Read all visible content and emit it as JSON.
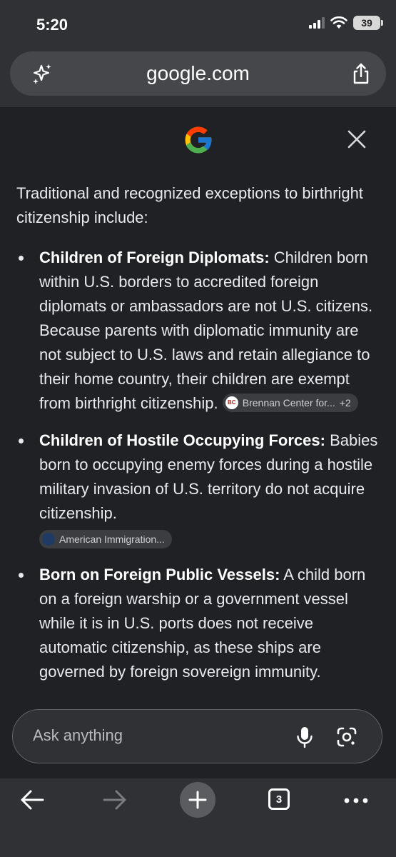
{
  "status_bar": {
    "time": "5:20",
    "battery": "39"
  },
  "address_bar": {
    "url": "google.com"
  },
  "answer": {
    "intro": "Traditional and recognized exceptions to birthright citizenship include:",
    "points": [
      {
        "term": "Children of Foreign Diplomats:",
        "text": " Children born within U.S. borders to accredited foreign diplomats or ambassadors are not U.S. citizens. Because parents with diplomatic immunity are not subject to U.S. laws and retain allegiance to their home country, their children are exempt from birthright citizenship. ",
        "source": "Brennan Center for...",
        "source_icon_text": "BC",
        "source_extra": "+2"
      },
      {
        "term": "Children of Hostile Occupying Forces:",
        "text": " Babies born to occupying enemy forces during a hostile military invasion of U.S. territory do not acquire citizenship.",
        "source": "American Immigration..."
      },
      {
        "term": "Born on Foreign Public Vessels:",
        "text": " A child born on a foreign warship or a government vessel while it is in U.S. ports does not receive automatic citizenship, as these ships are governed by foreign sovereign immunity."
      }
    ]
  },
  "ask": {
    "placeholder": "Ask anything"
  },
  "toolbar": {
    "tab_count": "3"
  },
  "colors": {
    "background": "#202124",
    "chrome": "#303134",
    "text": "#e8eaed"
  }
}
